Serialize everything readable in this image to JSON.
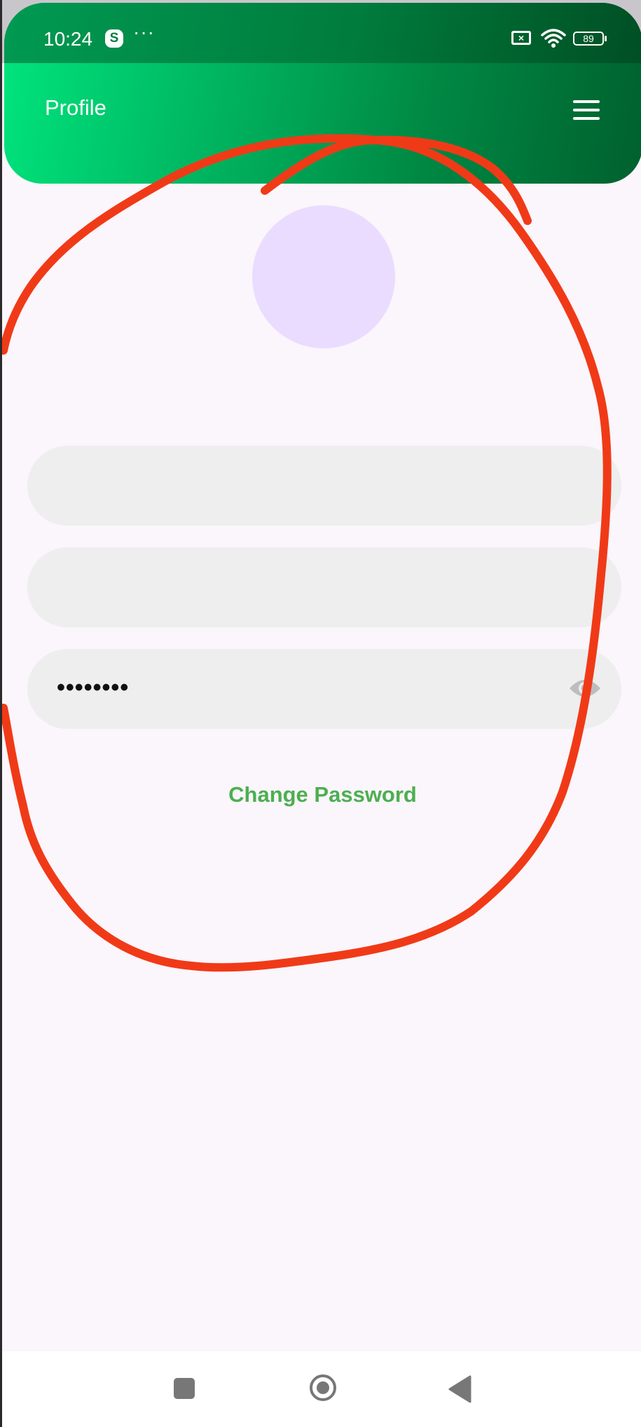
{
  "status_bar": {
    "time": "10:24",
    "skype_glyph": "S",
    "more_glyph": "···",
    "sim_glyph": "×",
    "battery_level": "89"
  },
  "app_bar": {
    "title": "Profile",
    "menu_icon": "hamburger-menu-icon"
  },
  "profile": {
    "avatar_color": "#eadcff",
    "name_value": "",
    "email_value": "",
    "password_mask": "••••••••",
    "password_toggle_icon": "eye-icon",
    "change_password_label": "Change Password"
  },
  "annotation": {
    "stroke_color": "#f03a17"
  },
  "colors": {
    "header_gradient_start": "#00e57e",
    "header_gradient_end": "#00602e",
    "accent_green": "#4caf50",
    "field_background": "#eeeeee",
    "page_background": "#fbf5fc"
  },
  "nav_bar": {
    "recents_icon": "square-recents-icon",
    "home_icon": "circle-home-icon",
    "back_icon": "triangle-back-icon"
  }
}
